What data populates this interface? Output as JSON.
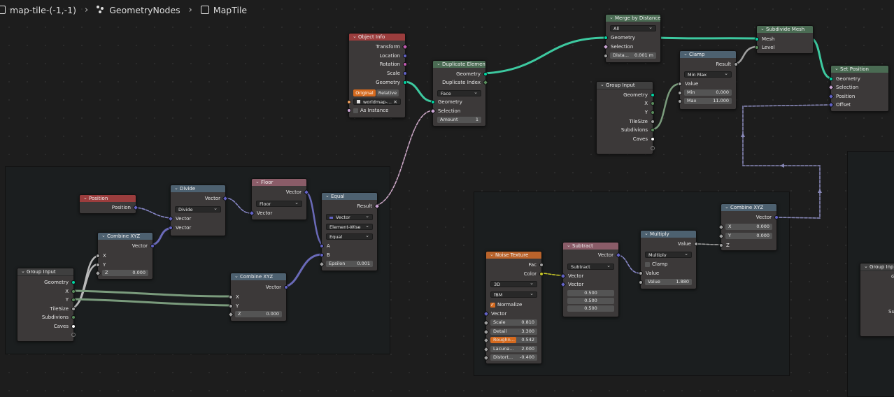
{
  "breadcrumb": {
    "object": "map-tile-(-1,-1)",
    "sep1": "›",
    "modifier": "GeometryNodes",
    "sep2": "›",
    "node_group": "MapTile"
  },
  "nodes": {
    "object_info": {
      "title": "Object Info",
      "outputs": [
        "Transform",
        "Location",
        "Rotation",
        "Scale",
        "Geometry"
      ],
      "mode_original": "Original",
      "mode_relative": "Relative",
      "object_value": "worldmap-...",
      "as_instance": "As Instance"
    },
    "duplicate_elements": {
      "title": "Duplicate Elements",
      "outputs": [
        "Geometry",
        "Duplicate Index"
      ],
      "domain": "Face",
      "inputs": [
        "Geometry",
        "Selection"
      ],
      "amount_label": "Amount",
      "amount_value": "1"
    },
    "merge_by_distance": {
      "title": "Merge by Distance",
      "mode": "All",
      "inputs": [
        "Geometry",
        "Selection"
      ],
      "distance_label": "Dista...",
      "distance_value": "0.001 m"
    },
    "subdivide_mesh": {
      "title": "Subdivide Mesh",
      "inputs": [
        "Mesh",
        "Level"
      ]
    },
    "set_position": {
      "title": "Set Position",
      "inputs": [
        "Geometry",
        "Selection",
        "Position",
        "Offset"
      ]
    },
    "clamp": {
      "title": "Clamp",
      "output": "Result",
      "mode": "Min Max",
      "input": "Value",
      "min_label": "Min",
      "min_value": "0.000",
      "max_label": "Max",
      "max_value": "11.000"
    },
    "group_input_top": {
      "title": "Group Input",
      "outputs": [
        "Geometry",
        "X",
        "Y",
        "TileSize",
        "Subdivions",
        "Caves"
      ]
    },
    "position": {
      "title": "Position",
      "output": "Position"
    },
    "divide": {
      "title": "Divide",
      "output": "Vector",
      "op": "Divide",
      "inputs": [
        "Vector",
        "Vector"
      ]
    },
    "floor": {
      "title": "Floor",
      "output": "Vector",
      "op": "Floor",
      "input": "Vector"
    },
    "equal": {
      "title": "Equal",
      "output": "Result",
      "type": "Vector",
      "mode": "Element-Wise",
      "op": "Equal",
      "inputs": [
        "A",
        "B"
      ],
      "epsilon_label": "Epsilon",
      "epsilon_value": "0.001"
    },
    "combine_xyz_1": {
      "title": "Combine XYZ",
      "output": "Vector",
      "inputs": [
        "X",
        "Y"
      ],
      "z_label": "Z",
      "z_value": "0.000"
    },
    "combine_xyz_2": {
      "title": "Combine XYZ",
      "output": "Vector",
      "inputs": [
        "X",
        "Y"
      ],
      "z_label": "Z",
      "z_value": "0.000"
    },
    "group_input_left": {
      "title": "Group Input",
      "outputs": [
        "Geometry",
        "X",
        "Y",
        "TileSize",
        "Subdivions",
        "Caves"
      ]
    },
    "noise_texture": {
      "title": "Noise Texture",
      "outputs": [
        "Fac",
        "Color"
      ],
      "dimensions": "3D",
      "type": "fBM",
      "normalize": "Normalize",
      "vector": "Vector",
      "params": [
        {
          "label": "Scale",
          "value": "0.810"
        },
        {
          "label": "Detail",
          "value": "3.300"
        },
        {
          "label": "Roughn...",
          "value": "0.542"
        },
        {
          "label": "Lacuna...",
          "value": "2.000"
        },
        {
          "label": "Distort...",
          "value": "-0.400"
        }
      ]
    },
    "subtract": {
      "title": "Subtract",
      "output": "Vector",
      "op": "Subtract",
      "inputs": [
        "Vector",
        "Vector"
      ],
      "values": [
        "0.500",
        "0.500",
        "0.500"
      ]
    },
    "multiply": {
      "title": "Multiply",
      "output": "Value",
      "op": "Multiply",
      "clamp": "Clamp",
      "input": "Value",
      "value_label": "Value",
      "value_value": "1.880"
    },
    "combine_xyz_3": {
      "title": "Combine XYZ",
      "output": "Vector",
      "x_label": "X",
      "x_value": "0.000",
      "y_label": "Y",
      "y_value": "0.000",
      "z": "Z"
    },
    "group_input_right": {
      "title": "Group Input",
      "partial1": "G",
      "partial2": "Su"
    }
  }
}
